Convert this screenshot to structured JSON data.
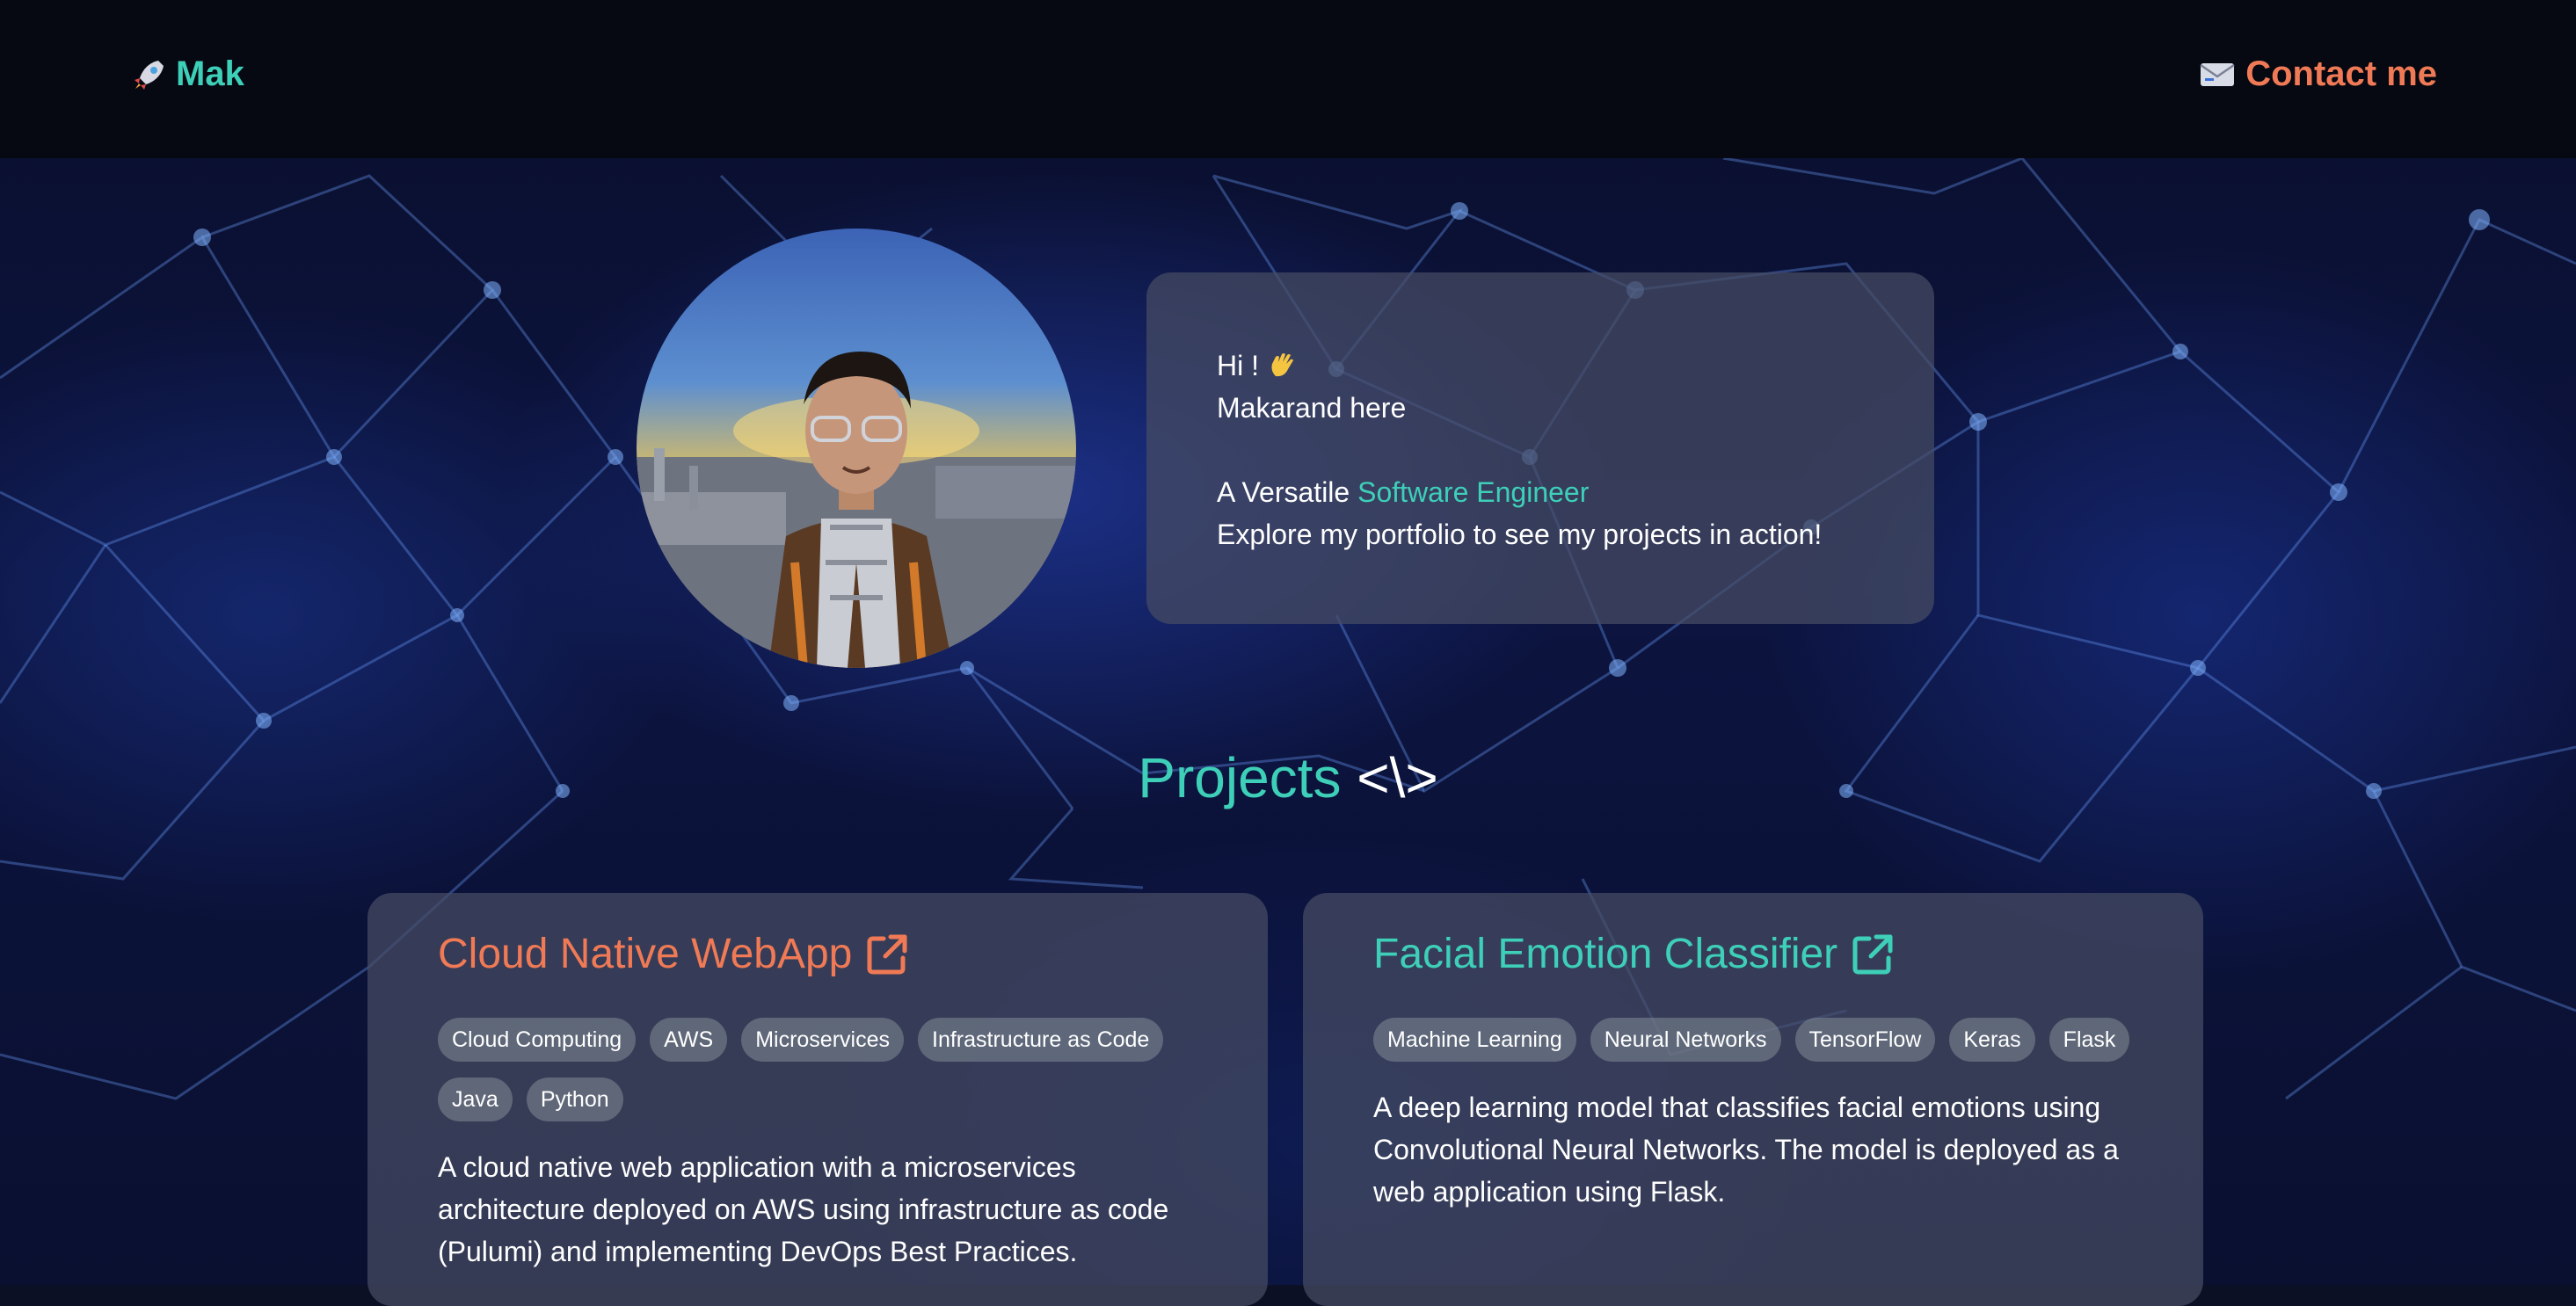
{
  "nav": {
    "brand_icon": "rocket-icon",
    "brand_label": "Mak",
    "contact_icon": "envelope-icon",
    "contact_label": "Contact me"
  },
  "intro": {
    "greeting": "Hi !",
    "greeting_icon": "waving-hand-icon",
    "name_line": "Makarand here",
    "versatile_prefix": "A Versatile ",
    "role": "Software Engineer",
    "explore": "Explore my portfolio to see my projects in action!"
  },
  "projects": {
    "title": "Projects",
    "symbol": "<\\>",
    "cards": [
      {
        "title": "Cloud Native WebApp",
        "color": "#f07a55",
        "tags": [
          "Cloud Computing",
          "AWS",
          "Microservices",
          "Infrastructure as Code",
          "Java",
          "Python"
        ],
        "description": "A cloud native web application with a microservices architecture deployed on AWS using infrastructure as code (Pulumi) and implementing DevOps Best Practices."
      },
      {
        "title": "Facial Emotion Classifier",
        "color": "#3ecfb8",
        "tags": [
          "Machine Learning",
          "Neural Networks",
          "TensorFlow",
          "Keras",
          "Flask"
        ],
        "description": "A deep learning model that classifies facial emotions using Convolutional Neural Networks. The model is deployed as a web application using Flask."
      }
    ]
  },
  "colors": {
    "accent_teal": "#3ecfb8",
    "accent_orange": "#f07a55"
  }
}
